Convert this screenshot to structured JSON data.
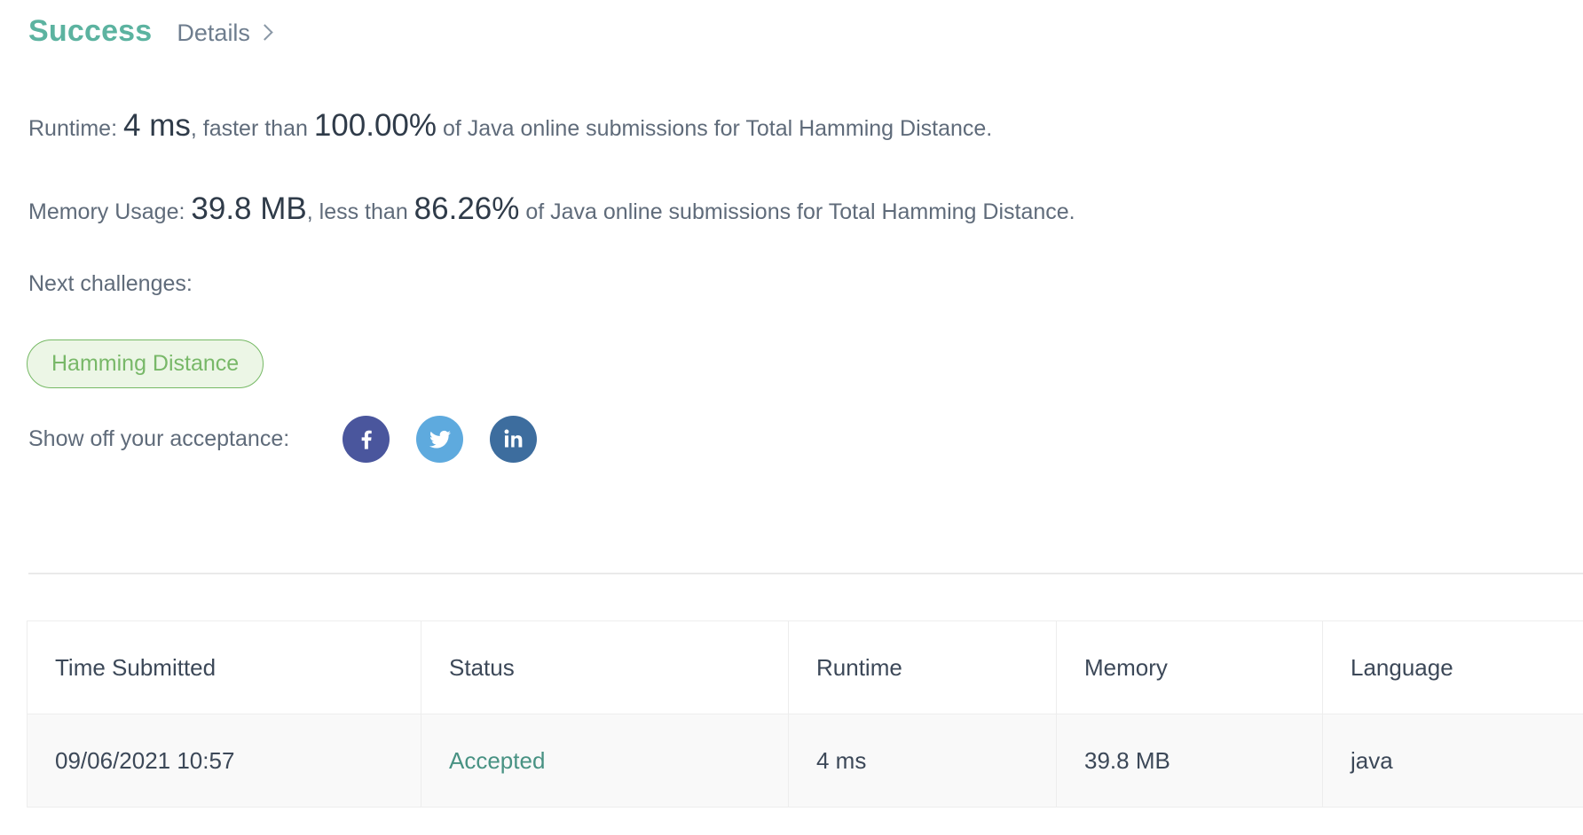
{
  "header": {
    "status": "Success",
    "details_label": "Details",
    "chevron_icon": "chevron-right-icon"
  },
  "runtime_line": {
    "label": "Runtime:",
    "value": "4 ms",
    "mid": ", faster than",
    "percent": "100.00%",
    "tail": "of Java online submissions for Total Hamming Distance."
  },
  "memory_line": {
    "label": "Memory Usage:",
    "value": "39.8 MB",
    "mid": ", less than",
    "percent": "86.26%",
    "tail": "of Java online submissions for Total Hamming Distance."
  },
  "next_challenges": {
    "label": "Next challenges:",
    "items": [
      {
        "label": "Hamming Distance"
      }
    ]
  },
  "share": {
    "label": "Show off your acceptance:",
    "buttons": [
      {
        "name": "facebook-icon",
        "color": "#4a569d"
      },
      {
        "name": "twitter-icon",
        "color": "#5eaade"
      },
      {
        "name": "linkedin-icon",
        "color": "#3d6d9e"
      }
    ]
  },
  "submissions": {
    "columns": [
      "Time Submitted",
      "Status",
      "Runtime",
      "Memory",
      "Language"
    ],
    "rows": [
      {
        "time": "09/06/2021 10:57",
        "status": "Accepted",
        "runtime": "4 ms",
        "memory": "39.8 MB",
        "language": "java"
      }
    ]
  },
  "colors": {
    "success": "#5cb3a0",
    "accepted": "#489283",
    "pill_border": "#76b965",
    "pill_bg": "#ecf6e6",
    "pill_text": "#78b868",
    "body_text": "#5f6b7a",
    "emphasis_text": "#2f3b49"
  }
}
